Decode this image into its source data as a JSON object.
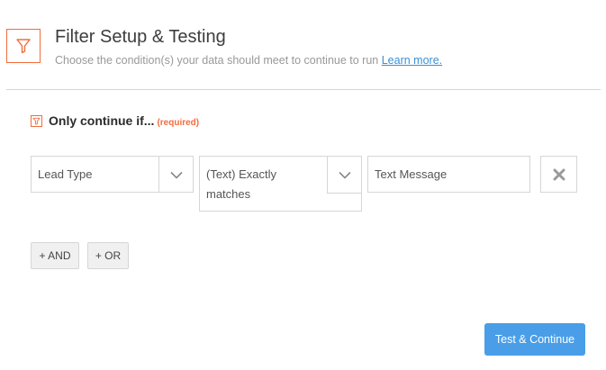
{
  "header": {
    "icon": "filter-icon",
    "title": "Filter Setup & Testing",
    "subtitle": "Choose the condition(s) your data should meet to continue to run",
    "learn_more": "Learn more."
  },
  "condition": {
    "icon": "filter-icon",
    "title": "Only continue if...",
    "required_label": "(required)",
    "field": {
      "value": "Lead Type",
      "icon": "chevron-down-icon"
    },
    "operator": {
      "value": "(Text) Exactly matches",
      "icon": "chevron-down-icon"
    },
    "value": {
      "value": "Text Message",
      "placeholder": ""
    },
    "remove_icon": "close-icon"
  },
  "actions": {
    "and_label": "+ AND",
    "or_label": "+ OR",
    "submit_label": "Test & Continue"
  },
  "colors": {
    "accent": "#f26d3d",
    "primary": "#4a9ee8",
    "link": "#3b8fd6"
  }
}
